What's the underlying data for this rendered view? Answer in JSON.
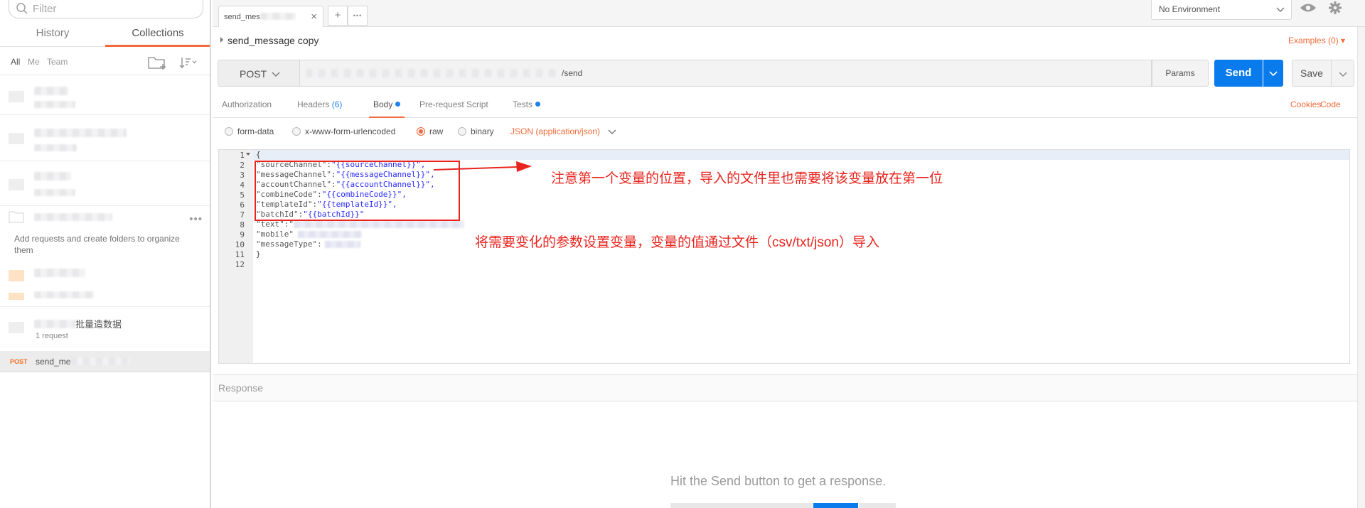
{
  "sidebar": {
    "filter_placeholder": "Filter",
    "tabs": {
      "history": "History",
      "collections": "Collections"
    },
    "filters": {
      "all": "All",
      "me": "Me",
      "team": "Team"
    },
    "empty_hint": "Add requests and create folders to organize them",
    "batch_collection": {
      "name_suffix": "批量造数据",
      "count": "1 request"
    },
    "active_request": {
      "method": "POST",
      "name": "send_me"
    }
  },
  "tabbar": {
    "open_tab": "send_mes",
    "close_glyph": "×",
    "add_glyph": "+",
    "more_glyph": "•••",
    "environment": "No Environment"
  },
  "request": {
    "title": "send_message copy",
    "examples": "Examples (0)",
    "method": "POST",
    "url_suffix": "/send",
    "params_label": "Params",
    "send_label": "Send",
    "save_label": "Save",
    "tabs": {
      "authorization": "Authorization",
      "headers": "Headers",
      "headers_count": "(6)",
      "body": "Body",
      "prerequest": "Pre-request Script",
      "tests": "Tests"
    },
    "cookies": "Cookies",
    "code": "Code",
    "body_types": {
      "form_data": "form-data",
      "urlencoded": "x-www-form-urlencoded",
      "raw": "raw",
      "binary": "binary",
      "json": "JSON (application/json)"
    }
  },
  "editor": {
    "line_numbers": [
      "1",
      "2",
      "3",
      "4",
      "5",
      "6",
      "7",
      "8",
      "9",
      "10",
      "11",
      "12"
    ],
    "l1": "{",
    "l2k": "\"sourceChannel\":",
    "l2v": "\"{{sourceChannel}}\",",
    "l3k": "\"messageChannel\":",
    "l3v": "\"{{messageChannel}}\",",
    "l4k": "\"accountChannel\":",
    "l4v": "\"{{accountChannel}}\",",
    "l5k": "\"combineCode\":",
    "l5v": "\"{{combineCode}}\",",
    "l6k": "\"templateId\":",
    "l6v": "\"{{templateId}}\",",
    "l7k": "\"batchId\":",
    "l7v": "\"{{batchId}}\"",
    "l8k": "\"text\":\"",
    "l9k": "\"mobile\"",
    "l10k": "\"messageType\":",
    "l11": "}"
  },
  "annotations": {
    "note1": "注意第一个变量的位置，导入的文件里也需要将该变量放在第一位",
    "note2": "将需要变化的参数设置变量，变量的值通过文件（csv/txt/json）导入"
  },
  "response": {
    "header": "Response",
    "empty_message": "Hit the Send button to get a response."
  },
  "colors": {
    "accent": "#f26b3a",
    "send_blue": "#097bed",
    "annotation_red": "#e8241e"
  }
}
